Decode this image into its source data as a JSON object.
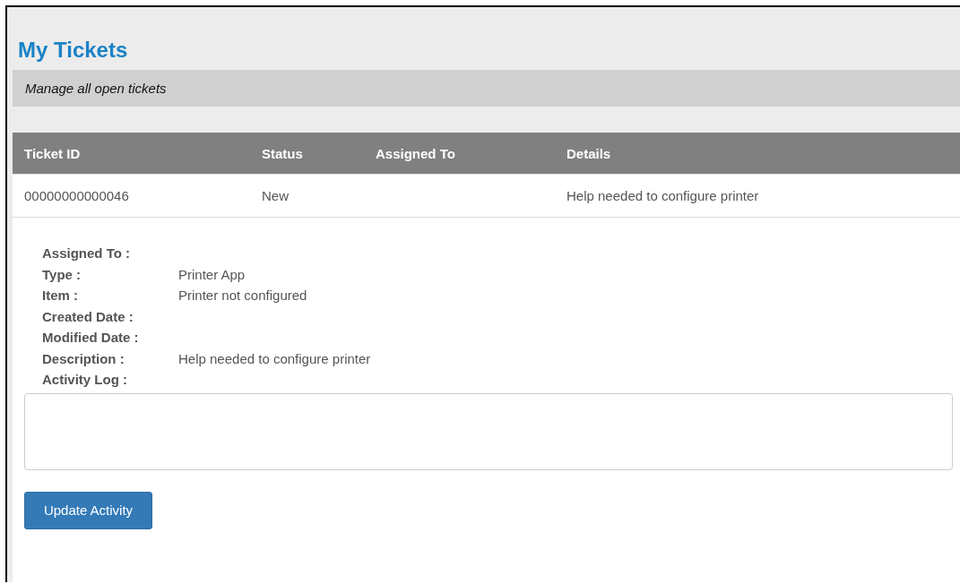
{
  "page": {
    "title": "My Tickets",
    "subtitle": "Manage all open tickets"
  },
  "table": {
    "columns": [
      "Ticket ID",
      "Status",
      "Assigned To",
      "Details"
    ],
    "rows": [
      {
        "ticket_id": "00000000000046",
        "status": "New",
        "details": "Help needed to configure printer"
      }
    ]
  },
  "details": {
    "fields": [
      {
        "label": "Assigned To :"
      },
      {
        "label": "Type :",
        "value": "Printer App"
      },
      {
        "label": "Item :",
        "value": "Printer not configured"
      },
      {
        "label": "Created Date :"
      },
      {
        "label": "Modified Date :"
      },
      {
        "label": "Description :",
        "value": "Help needed to configure printer"
      },
      {
        "label": "Activity Log :"
      }
    ],
    "button": "Update Activity"
  }
}
